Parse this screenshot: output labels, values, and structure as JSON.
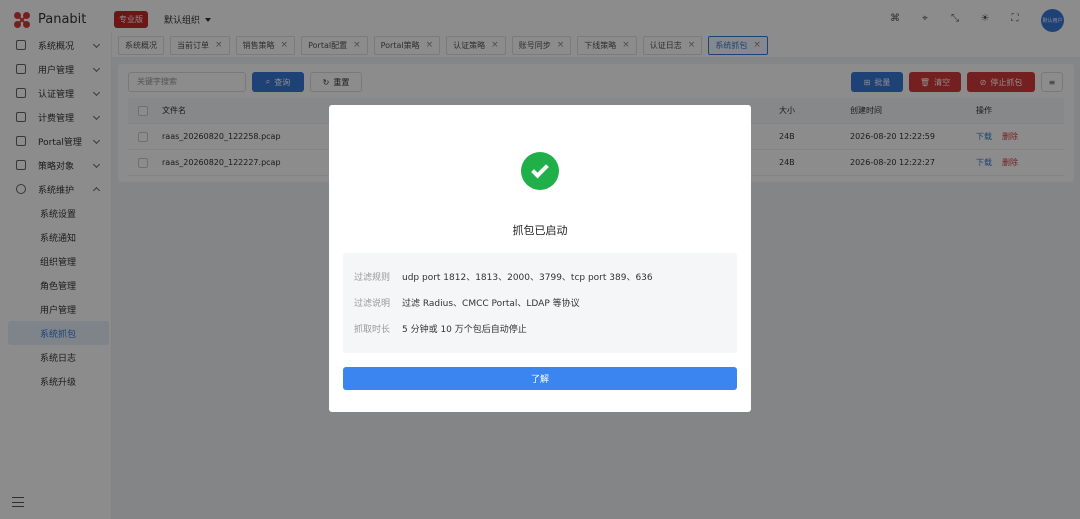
{
  "app": {
    "logo_text": "Panabit",
    "edition_badge": "专业版",
    "org_selector": "默认组织",
    "avatar_text": "默认用户"
  },
  "sidebar": {
    "items": [
      {
        "label": "系统概况"
      },
      {
        "label": "用户管理"
      },
      {
        "label": "认证管理"
      },
      {
        "label": "计费管理"
      },
      {
        "label": "Portal管理"
      },
      {
        "label": "策略对象"
      },
      {
        "label": "系统维护"
      }
    ],
    "sub_items": [
      {
        "label": "系统设置"
      },
      {
        "label": "系统通知"
      },
      {
        "label": "组织管理"
      },
      {
        "label": "角色管理"
      },
      {
        "label": "用户管理"
      },
      {
        "label": "系统抓包"
      },
      {
        "label": "系统日志"
      },
      {
        "label": "系统升级"
      }
    ]
  },
  "tabs": [
    {
      "label": "系统概况",
      "closable": false
    },
    {
      "label": "当前订单",
      "closable": true
    },
    {
      "label": "销售策略",
      "closable": true
    },
    {
      "label": "Portal配置",
      "closable": true
    },
    {
      "label": "Portal策略",
      "closable": true
    },
    {
      "label": "认证策略",
      "closable": true
    },
    {
      "label": "账号同步",
      "closable": true
    },
    {
      "label": "下线策略",
      "closable": true
    },
    {
      "label": "认证日志",
      "closable": true
    },
    {
      "label": "系统抓包",
      "closable": true
    }
  ],
  "toolbar": {
    "search_placeholder": "关键字搜索",
    "query_label": "查询",
    "reset_label": "重置",
    "batch_label": "批量",
    "clear_label": "清空",
    "stop_label": "停止抓包"
  },
  "table": {
    "headers": {
      "name": "文件名",
      "size": "大小",
      "time": "创建时间",
      "op": "操作"
    },
    "rows": [
      {
        "name": "raas_20260820_122258.pcap",
        "size": "24B",
        "time": "2026-08-20 12:22:59",
        "download": "下载",
        "delete": "删除"
      },
      {
        "name": "raas_20260820_122227.pcap",
        "size": "24B",
        "time": "2026-08-20 12:22:27",
        "download": "下载",
        "delete": "删除"
      }
    ]
  },
  "modal": {
    "title": "抓包已启动",
    "rows": [
      {
        "label": "过滤规则",
        "value": "udp port 1812、1813、2000、3799、tcp port 389、636"
      },
      {
        "label": "过滤说明",
        "value": "过滤 Radius、CMCC Portal、LDAP 等协议"
      },
      {
        "label": "抓取时长",
        "value": "5 分钟或 10 万个包后自动停止"
      }
    ],
    "ok_label": "了解"
  },
  "colors": {
    "accent": "#3a78d8",
    "danger": "#d63b3b",
    "success": "#1fb04a",
    "brand": "#c62828"
  }
}
